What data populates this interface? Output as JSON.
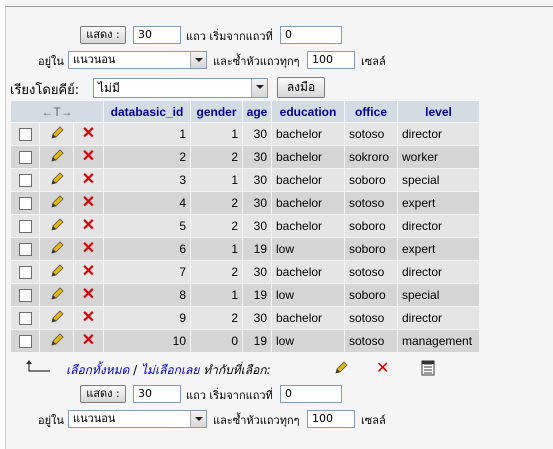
{
  "top_nav": {
    "show_label": "แสดง :",
    "rows_value": "30",
    "rows_from_label": "แถว เริ่มจากแถวที่",
    "start_value": "0",
    "in_label": "อยู่ใน",
    "orientation_value": "แนวนอน",
    "repeat_label": "และซ้ำหัวแถวทุกๆ",
    "repeat_value": "100",
    "cells_label": "เซลล์"
  },
  "sort": {
    "label": "เรียงโดยคีย์:",
    "value": "ไม่มี",
    "go_label": "ลงมือ"
  },
  "table": {
    "nav_arrows": "←T→",
    "columns": [
      "databasic_id",
      "gender",
      "age",
      "education",
      "office",
      "level"
    ],
    "rows": [
      [
        "1",
        "1",
        "30",
        "bachelor",
        "sotoso",
        "director"
      ],
      [
        "2",
        "2",
        "30",
        "bachelor",
        "sokroro",
        "worker"
      ],
      [
        "3",
        "1",
        "30",
        "bachelor",
        "soboro",
        "special"
      ],
      [
        "4",
        "2",
        "30",
        "bachelor",
        "sotoso",
        "expert"
      ],
      [
        "5",
        "2",
        "30",
        "bachelor",
        "soboro",
        "director"
      ],
      [
        "6",
        "1",
        "19",
        "low",
        "soboro",
        "expert"
      ],
      [
        "7",
        "2",
        "30",
        "bachelor",
        "sotoso",
        "director"
      ],
      [
        "8",
        "1",
        "19",
        "low",
        "soboro",
        "special"
      ],
      [
        "9",
        "2",
        "30",
        "bachelor",
        "sotoso",
        "director"
      ],
      [
        "10",
        "0",
        "19",
        "low",
        "sotoso",
        "management"
      ]
    ]
  },
  "selection": {
    "select_all": "เลือกทั้งหมด",
    "separator": "/",
    "select_none": "ไม่เลือกเลย",
    "with_selected": "ทำกับที่เลือก:"
  },
  "bottom_nav": {
    "show_label": "แสดง :",
    "rows_value": "30",
    "rows_from_label": "แถว เริ่มจากแถวที่",
    "start_value": "0",
    "in_label": "อยู่ใน",
    "orientation_value": "แนวนอน",
    "repeat_label": "และซ้ำหัวแถวทุกๆ",
    "repeat_value": "100",
    "cells_label": "เซลล์"
  },
  "colors": {
    "header_bg": "#d3dce3",
    "header_text": "#0000a0",
    "row_odd": "#e5e5e5",
    "row_even": "#d5d5d5",
    "delete_red": "#d60000"
  }
}
